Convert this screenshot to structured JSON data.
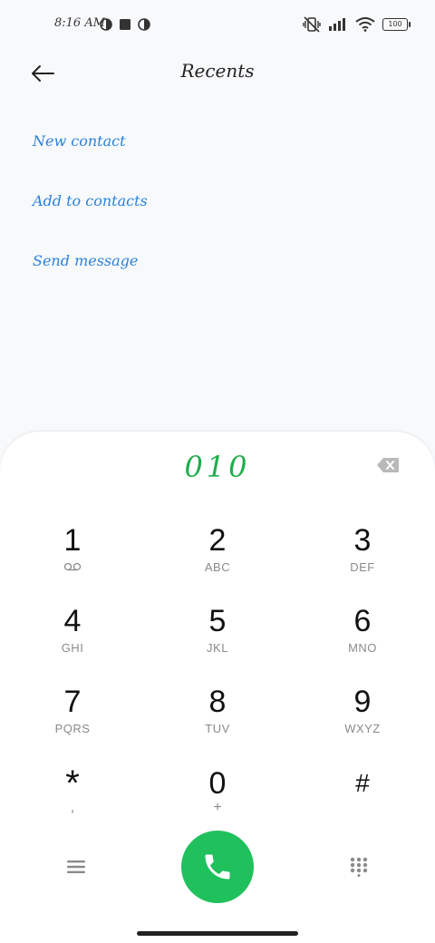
{
  "status_bar": {
    "time": "8:16 AM",
    "battery": "100"
  },
  "header": {
    "title": "Recents",
    "back_icon": "arrow-left-icon"
  },
  "actions": [
    {
      "label": "New contact"
    },
    {
      "label": "Add to contacts"
    },
    {
      "label": "Send message"
    }
  ],
  "dialer": {
    "number": "010",
    "keys": [
      {
        "digit": "1",
        "letters": ""
      },
      {
        "digit": "2",
        "letters": "ABC"
      },
      {
        "digit": "3",
        "letters": "DEF"
      },
      {
        "digit": "4",
        "letters": "GHI"
      },
      {
        "digit": "5",
        "letters": "JKL"
      },
      {
        "digit": "6",
        "letters": "MNO"
      },
      {
        "digit": "7",
        "letters": "PQRS"
      },
      {
        "digit": "8",
        "letters": "TUV"
      },
      {
        "digit": "9",
        "letters": "WXYZ"
      },
      {
        "digit": "*",
        "letters": ","
      },
      {
        "digit": "0",
        "letters": "+"
      },
      {
        "digit": "#",
        "letters": ""
      }
    ]
  },
  "colors": {
    "accent_blue": "#2b82d9",
    "number_green": "#1fae4c",
    "call_green": "#20c05c"
  }
}
